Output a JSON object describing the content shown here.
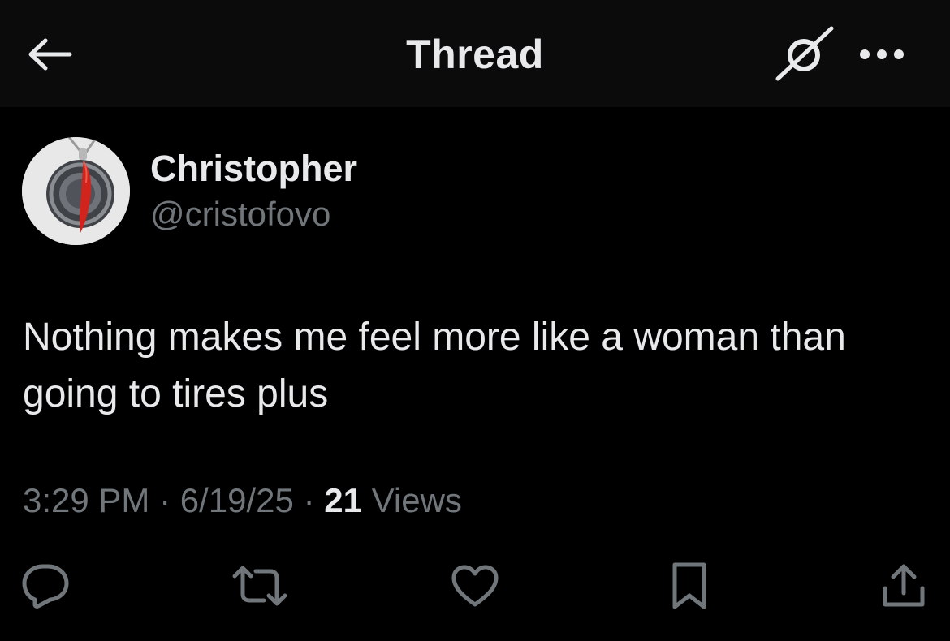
{
  "header": {
    "title": "Thread",
    "back_icon": "arrow-left-icon",
    "grok_icon": "grok-slash-circle-icon",
    "more_icon": "ellipsis-icon"
  },
  "post": {
    "author": {
      "display_name": "Christopher",
      "handle": "@cristofovo",
      "avatar": "pendant-with-red-horn-avatar"
    },
    "text_line_1": "Nothing makes me feel more like a woman than",
    "text_line_2": "going to tires plus",
    "time": "3:29 PM",
    "separator": "·",
    "date": "6/19/25",
    "views_count": "21",
    "views_label": "Views"
  },
  "actions": {
    "reply_icon": "reply-bubble-icon",
    "repost_icon": "repost-icon",
    "like_icon": "heart-icon",
    "bookmark_icon": "bookmark-icon",
    "share_icon": "share-upload-icon"
  },
  "colors": {
    "background": "#000000",
    "header_background": "#0b0b0c",
    "primary_text": "#e7e9ea",
    "secondary_text": "#71767b",
    "avatar_accent": "#d0241c"
  }
}
